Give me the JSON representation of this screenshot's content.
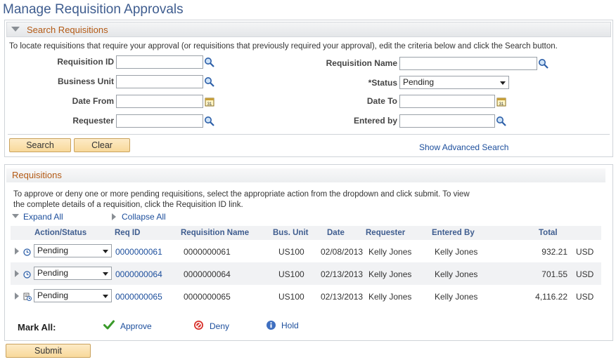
{
  "page": {
    "title": "Manage Requisition Approvals"
  },
  "search": {
    "header": "Search Requisitions",
    "instructions": "To locate requisitions that require your approval (or requisitions that previously required your approval), edit the criteria below and click the Search button.",
    "labels": {
      "requisition_id": "Requisition ID",
      "business_unit": "Business Unit",
      "date_from": "Date From",
      "requester": "Requester",
      "requisition_name": "Requisition Name",
      "status": "*Status",
      "date_to": "Date To",
      "entered_by": "Entered by"
    },
    "values": {
      "requisition_id": "",
      "business_unit": "",
      "date_from": "",
      "requester": "",
      "requisition_name": "",
      "status": "Pending",
      "date_to": "",
      "entered_by": ""
    },
    "buttons": {
      "search": "Search",
      "clear": "Clear"
    },
    "advanced_link": "Show Advanced Search"
  },
  "requisitions": {
    "header": "Requisitions",
    "instructions_line1": "To approve or deny one or more pending requisitions, select the appropriate action from the dropdown and click submit. To view",
    "instructions_line2": "the complete details of a requisition, click the Requisition ID link.",
    "expand_all": "Expand All",
    "collapse_all": "Collapse All",
    "columns": [
      "Action/Status",
      "Req ID",
      "Requisition Name",
      "Bus. Unit",
      "Date",
      "Requester",
      "Entered By",
      "Total"
    ],
    "rows": [
      {
        "action": "Pending",
        "icon": "clock-icon",
        "req_id": "0000000061",
        "name": "0000000061",
        "bus_unit": "US100",
        "date": "02/08/2013",
        "requester": "Kelly Jones",
        "entered_by": "Kelly Jones",
        "total": "932.21",
        "currency": "USD"
      },
      {
        "action": "Pending",
        "icon": "clock-icon",
        "req_id": "0000000064",
        "name": "0000000064",
        "bus_unit": "US100",
        "date": "02/13/2013",
        "requester": "Kelly Jones",
        "entered_by": "Kelly Jones",
        "total": "701.55",
        "currency": "USD"
      },
      {
        "action": "Pending",
        "icon": "document-clock-icon",
        "req_id": "0000000065",
        "name": "0000000065",
        "bus_unit": "US100",
        "date": "02/13/2013",
        "requester": "Kelly Jones",
        "entered_by": "Kelly Jones",
        "total": "4,116.22",
        "currency": "USD"
      }
    ],
    "mark_all": {
      "label": "Mark All:",
      "approve": "Approve",
      "deny": "Deny",
      "hold": "Hold"
    }
  },
  "submit": "Submit",
  "colors": {
    "title_blue": "#3f5d8f",
    "section_orange": "#b35a15",
    "link_blue": "#1c4e9c",
    "button_gold": "#f8d99a",
    "approve_green": "#3a9a2a",
    "deny_red": "#d8302a",
    "hold_blue": "#3f6fc0"
  }
}
